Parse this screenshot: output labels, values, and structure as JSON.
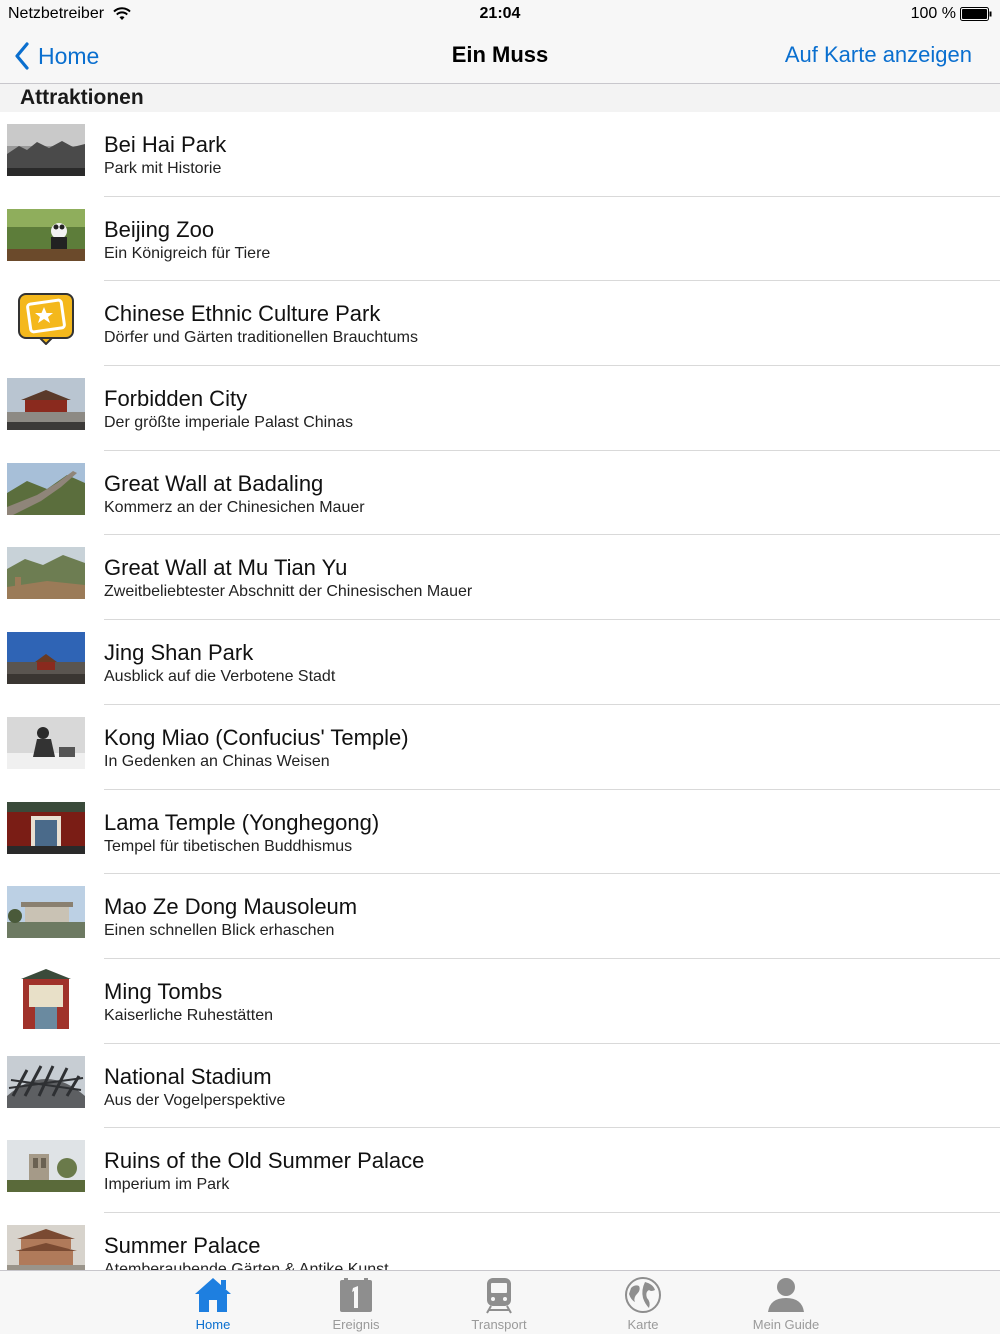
{
  "status": {
    "carrier": "Netzbetreiber",
    "time": "21:04",
    "battery": "100 %"
  },
  "nav": {
    "back_label": "Home",
    "title": "Ein Muss",
    "right_label": "Auf Karte anzeigen"
  },
  "section": {
    "title": "Attraktionen"
  },
  "items": [
    {
      "title": "Bei Hai Park",
      "subtitle": "Park mit Historie"
    },
    {
      "title": "Beijing Zoo",
      "subtitle": "Ein Königreich für Tiere"
    },
    {
      "title": "Chinese Ethnic Culture Park",
      "subtitle": "Dörfer und Gärten traditionellen Brauchtums"
    },
    {
      "title": "Forbidden City",
      "subtitle": "Der größte imperiale Palast Chinas"
    },
    {
      "title": "Great Wall at Badaling",
      "subtitle": "Kommerz an der Chinesichen Mauer"
    },
    {
      "title": "Great Wall at Mu Tian Yu",
      "subtitle": "Zweitbeliebtester Abschnitt der Chinesischen Mauer"
    },
    {
      "title": "Jing Shan Park",
      "subtitle": "Ausblick auf die Verbotene Stadt"
    },
    {
      "title": "Kong Miao (Confucius' Temple)",
      "subtitle": "In Gedenken an Chinas Weisen"
    },
    {
      "title": "Lama Temple (Yonghegong)",
      "subtitle": "Tempel für tibetischen Buddhismus"
    },
    {
      "title": "Mao Ze Dong Mausoleum",
      "subtitle": "Einen schnellen Blick erhaschen"
    },
    {
      "title": "Ming Tombs",
      "subtitle": "Kaiserliche Ruhestätten"
    },
    {
      "title": "National Stadium",
      "subtitle": "Aus der Vogelperspektive"
    },
    {
      "title": "Ruins of the Old Summer Palace",
      "subtitle": "Imperium im Park"
    },
    {
      "title": "Summer Palace",
      "subtitle": "Atemberaubende Gärten & Antike Kunst"
    }
  ],
  "tabs": [
    {
      "label": "Home",
      "icon": "home-icon",
      "active": true
    },
    {
      "label": "Ereignis",
      "icon": "calendar-icon",
      "active": false
    },
    {
      "label": "Transport",
      "icon": "train-icon",
      "active": false
    },
    {
      "label": "Karte",
      "icon": "globe-icon",
      "active": false
    },
    {
      "label": "Mein Guide",
      "icon": "person-icon",
      "active": false
    }
  ],
  "colors": {
    "accent": "#0a6fcf",
    "tab_inactive": "#9a9a9a",
    "bar_bg": "#f7f7f7"
  }
}
